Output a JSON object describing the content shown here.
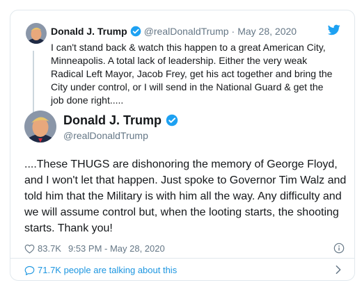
{
  "reply": {
    "name": "Donald J. Trump",
    "handle": "@realDonaldTrump",
    "separator": "·",
    "date": "May 28, 2020",
    "text": "I can't stand back & watch this happen to a great American City, Minneapolis. A total lack of leadership. Either the very weak Radical Left Mayor, Jacob Frey, get his act together and bring the City under control, or I will send in the National Guard & get the job done right....."
  },
  "tweet": {
    "name": "Donald J. Trump",
    "handle": "@realDonaldTrump",
    "text": "....These THUGS are dishonoring the memory of George Floyd, and I won't let that happen. Just spoke to Governor Tim Walz and told him that the Military is with him all the way. Any difficulty and we will assume control but, when the looting starts, the shooting starts. Thank you!",
    "likes": "83.7K",
    "timestamp": "9:53 PM - May 28, 2020"
  },
  "footer": {
    "talking": "71.7K people are talking about this"
  },
  "icons": {
    "bird": "twitter-bird-icon",
    "verified": "verified-badge-icon",
    "heart": "heart-icon",
    "info": "info-icon",
    "bubble": "comment-bubble-icon",
    "chevron": "chevron-right-icon"
  },
  "colors": {
    "brand": "#1da1f2",
    "link": "#1b95e0",
    "secondary_text": "#657786",
    "border": "#e1e8ed"
  }
}
